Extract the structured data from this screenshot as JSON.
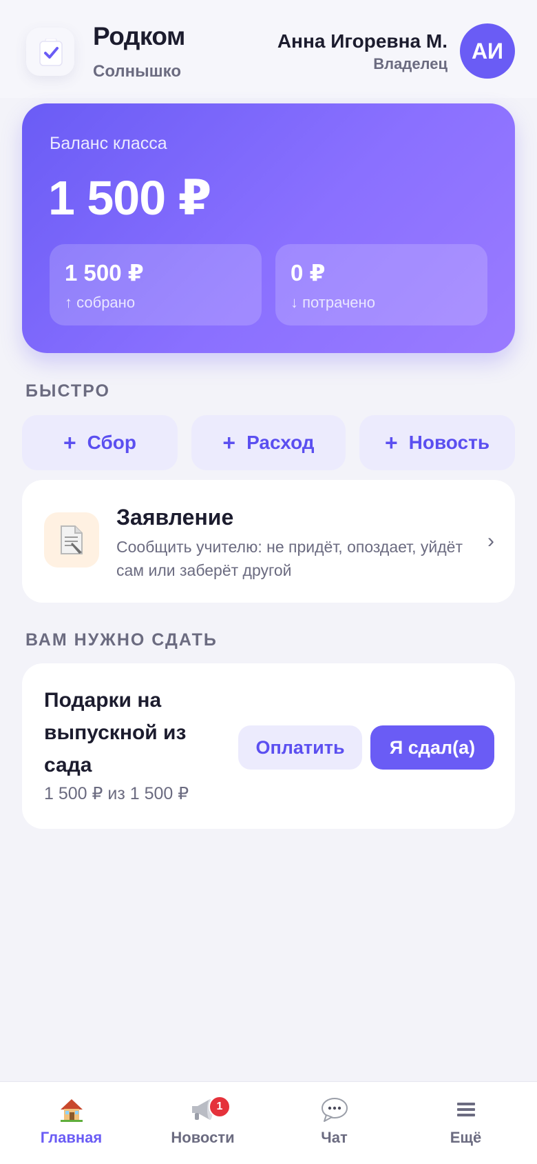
{
  "header": {
    "app_title": "Родком",
    "group_name": "Солнышко",
    "user_name": "Анна Игоревна М.",
    "user_role": "Владелец",
    "avatar_initials": "АИ"
  },
  "balance": {
    "label": "Баланс класса",
    "value": "1 500 ₽",
    "collected_value": "1 500 ₽",
    "collected_label": "↑ собрано",
    "spent_value": "0 ₽",
    "spent_label": "↓ потрачено"
  },
  "quick": {
    "title": "БЫСТРО",
    "actions": [
      {
        "plus": "+",
        "label": "Сбор"
      },
      {
        "plus": "+",
        "label": "Расход"
      },
      {
        "plus": "+",
        "label": "Новость"
      }
    ]
  },
  "statement": {
    "icon": "document-icon",
    "title": "Заявление",
    "description": "Сообщить учителю: не придёт, опоздает, уйдёт сам или заберёт другой",
    "chevron": "›"
  },
  "due": {
    "section_title": "ВАМ НУЖНО СДАТЬ",
    "item_title": "Подарки на выпускной из сада",
    "amount": "1 500 ₽ из 1 500 ₽",
    "pay_label": "Оплатить",
    "done_label": "Я сдал(а)"
  },
  "tabbar": {
    "tabs": [
      {
        "label": "Главная",
        "icon": "house-icon",
        "active": true
      },
      {
        "label": "Новости",
        "icon": "megaphone-icon",
        "badge": "1"
      },
      {
        "label": "Чат",
        "icon": "speech-bubble-icon"
      },
      {
        "label": "Ещё",
        "icon": "menu-icon"
      }
    ]
  },
  "colors": {
    "accent": "#6a5cf5",
    "background": "#f3f3f9",
    "badge": "#e5323b"
  }
}
